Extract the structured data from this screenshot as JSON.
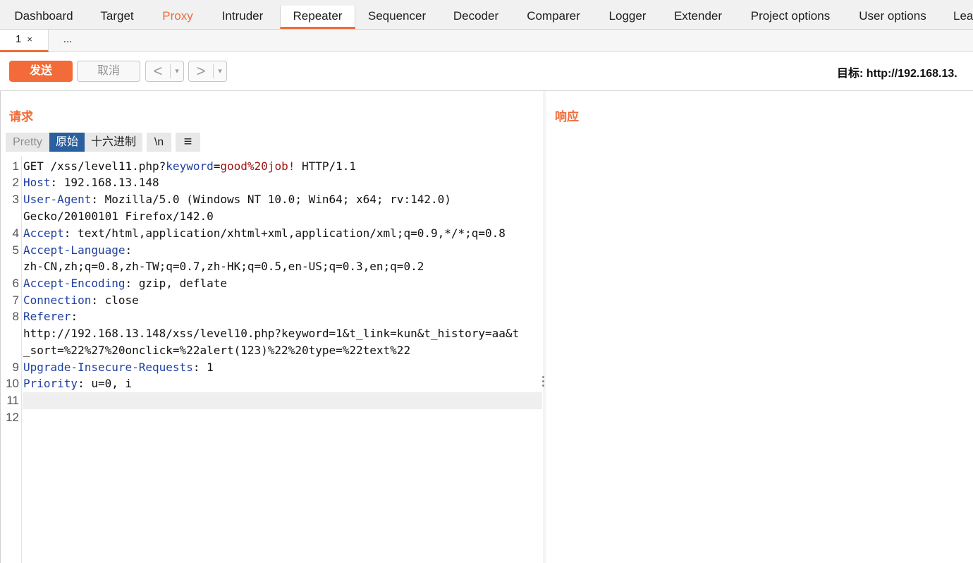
{
  "top_tabs": [
    "Dashboard",
    "Target",
    "Proxy",
    "Intruder",
    "Repeater",
    "Sequencer",
    "Decoder",
    "Comparer",
    "Logger",
    "Extender",
    "Project options",
    "User options",
    "Lea"
  ],
  "active_top_tab": "Repeater",
  "sub_tabs": {
    "first": "1",
    "close": "×",
    "more": "..."
  },
  "toolbar": {
    "send": "发送",
    "cancel": "取消",
    "back": "<",
    "forward": ">",
    "dropdown": "▾",
    "target": "目标: http://192.168.13."
  },
  "request": {
    "title": "请求",
    "views": [
      "Pretty",
      "原始",
      "十六进制",
      "\\n",
      "≡"
    ],
    "active_view": "原始",
    "line_numbers": [
      "1",
      "2",
      "3",
      "4",
      "5",
      "6",
      "7",
      "8",
      "9",
      "10",
      "11",
      "12"
    ],
    "l1": {
      "method": "GET /xss/level11.php?",
      "param": "keyword",
      "eq": "=",
      "value": "good%20job!",
      "proto": " HTTP/1.1"
    },
    "l2": {
      "h": "Host",
      "v": ": 192.168.13.148"
    },
    "l3": {
      "h": "User-Agent",
      "v": ": Mozilla/5.0 (Windows NT 10.0; Win64; x64; rv:142.0)",
      "cont": "Gecko/20100101 Firefox/142.0"
    },
    "l4": {
      "h": "Accept",
      "v": ": text/html,application/xhtml+xml,application/xml;q=0.9,*/*;q=0.8"
    },
    "l5": {
      "h": "Accept-Language",
      "v": ":",
      "cont": "zh-CN,zh;q=0.8,zh-TW;q=0.7,zh-HK;q=0.5,en-US;q=0.3,en;q=0.2"
    },
    "l6": {
      "h": "Accept-Encoding",
      "v": ": gzip, deflate"
    },
    "l7": {
      "h": "Connection",
      "v": ": close"
    },
    "l8": {
      "h": "Referer",
      "v": ":",
      "cont1": "http://192.168.13.148/xss/level10.php?keyword=1&t_link=kun&t_history=aa&t",
      "cont2": "_sort=%22%27%20onclick=%22alert(123)%22%20type=%22text%22"
    },
    "l9": {
      "h": "Upgrade-Insecure-Requests",
      "v": ": 1"
    },
    "l10": {
      "h": "Priority",
      "v": ": u=0, i"
    }
  },
  "response": {
    "title": "响应"
  },
  "colors": {
    "accent": "#ef6b3a",
    "active_view": "#2a5fa0",
    "header_name": "#1f3fa0",
    "param_value": "#a01010"
  }
}
